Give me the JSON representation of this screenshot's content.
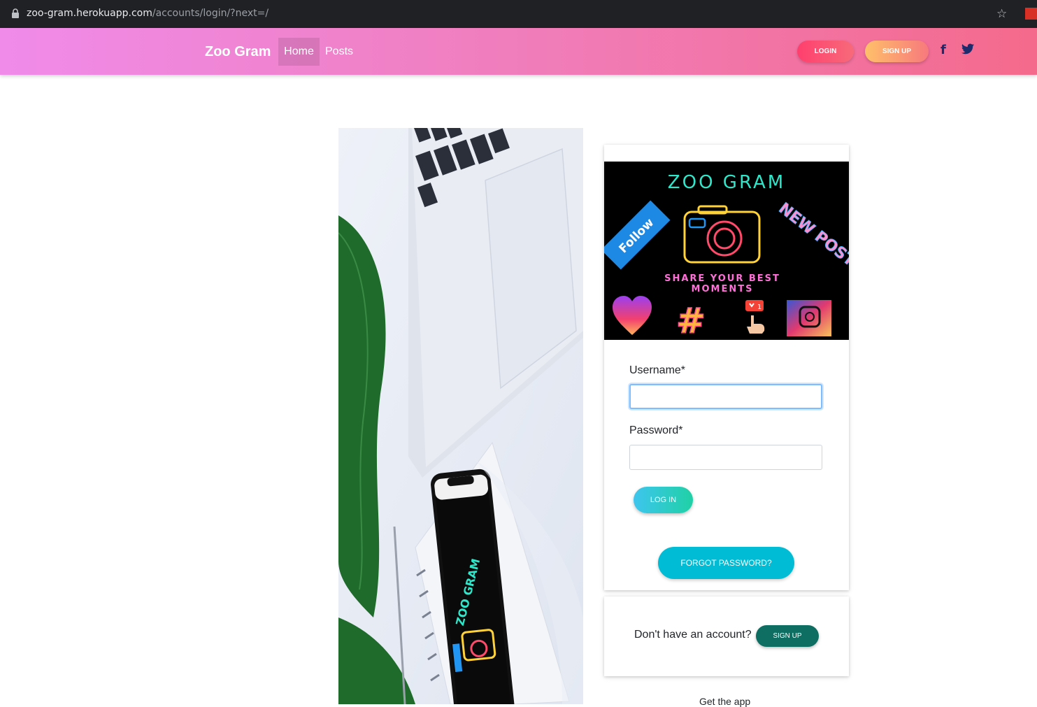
{
  "browser": {
    "url_host": "zoo-gram.herokuapp.com",
    "url_path": "/accounts/login/?next=/"
  },
  "navbar": {
    "brand": "Zoo Gram",
    "links": [
      "Home",
      "Posts"
    ],
    "login_label": "LOGIN",
    "signup_label": "SIGN UP",
    "social_icons": [
      "facebook-icon",
      "twitter-icon"
    ]
  },
  "banner": {
    "title": "ZOO GRAM",
    "follow": "Follow",
    "new_post": "NEW POST",
    "tagline_1": "SHARE YOUR BEST",
    "tagline_2": "MOMENTS",
    "hashtag": "#",
    "notification_count": "1"
  },
  "hero": {
    "phone_text": "ZOO GRAM"
  },
  "form": {
    "username_label": "Username*",
    "password_label": "Password*",
    "username_value": "",
    "password_value": "",
    "login_button": "LOG IN",
    "forgot_button": "FORGOT PASSWORD?"
  },
  "signup_card": {
    "prompt": "Don't have an account?",
    "button": "SIGN UP"
  },
  "footer": {
    "get_app": "Get the app"
  },
  "colors": {
    "nav_gradient_start": "#f08bea",
    "nav_gradient_end": "#f46a8c",
    "forgot_button": "#00bcd4",
    "signup_button": "#0d6e61"
  }
}
